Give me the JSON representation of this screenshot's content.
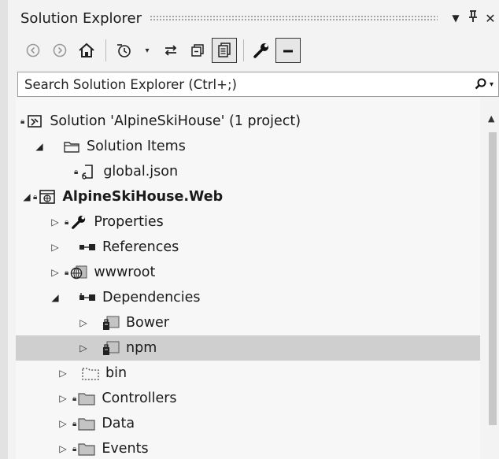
{
  "window": {
    "title": "Solution Explorer",
    "dropdown_glyph": "▼",
    "pin_glyph": "╤",
    "close_glyph": "✕"
  },
  "toolbar": {
    "buttons": [
      "back-icon",
      "forward-icon",
      "home-icon",
      "history-icon",
      "sync-icon",
      "collapse-all-icon",
      "show-all-files-icon",
      "properties-wrench-icon",
      "preview-icon"
    ]
  },
  "search": {
    "placeholder": "Search Solution Explorer (Ctrl+;)",
    "icon": "⚲"
  },
  "tree": {
    "items": [
      {
        "label": "Solution 'AlpineSkiHouse' (1 project)",
        "icon": "solution-icon",
        "expander": "",
        "lock": true
      },
      {
        "label": "Solution Items",
        "icon": "folder-icon",
        "expander": "◢",
        "lock": false
      },
      {
        "label": "global.json",
        "icon": "json-file-icon",
        "expander": "",
        "lock": true
      },
      {
        "label": "AlpineSkiHouse.Web",
        "icon": "web-project-icon",
        "expander": "◢",
        "lock": true,
        "bold": true
      },
      {
        "label": "Properties",
        "icon": "wrench-icon",
        "expander": "▷",
        "lock": true
      },
      {
        "label": "References",
        "icon": "references-icon",
        "expander": "▷",
        "lock": false
      },
      {
        "label": "wwwroot",
        "icon": "globe-folder-icon",
        "expander": "▷",
        "lock": true
      },
      {
        "label": "Dependencies",
        "icon": "dependencies-icon",
        "expander": "◢",
        "lock": false
      },
      {
        "label": "Bower",
        "icon": "package-folder-icon",
        "expander": "▷",
        "lock": false
      },
      {
        "label": "npm",
        "icon": "package-folder-icon",
        "expander": "▷",
        "lock": false,
        "selected": true
      },
      {
        "label": "bin",
        "icon": "dotted-folder-icon",
        "expander": "▷",
        "lock": false
      },
      {
        "label": "Controllers",
        "icon": "folder-icon",
        "expander": "▷",
        "lock": true
      },
      {
        "label": "Data",
        "icon": "folder-icon",
        "expander": "▷",
        "lock": true
      },
      {
        "label": "Events",
        "icon": "folder-icon",
        "expander": "▷",
        "lock": true
      }
    ]
  },
  "colors": {
    "selected_row": "#cfcfcf",
    "background": "#f3f3f3"
  }
}
